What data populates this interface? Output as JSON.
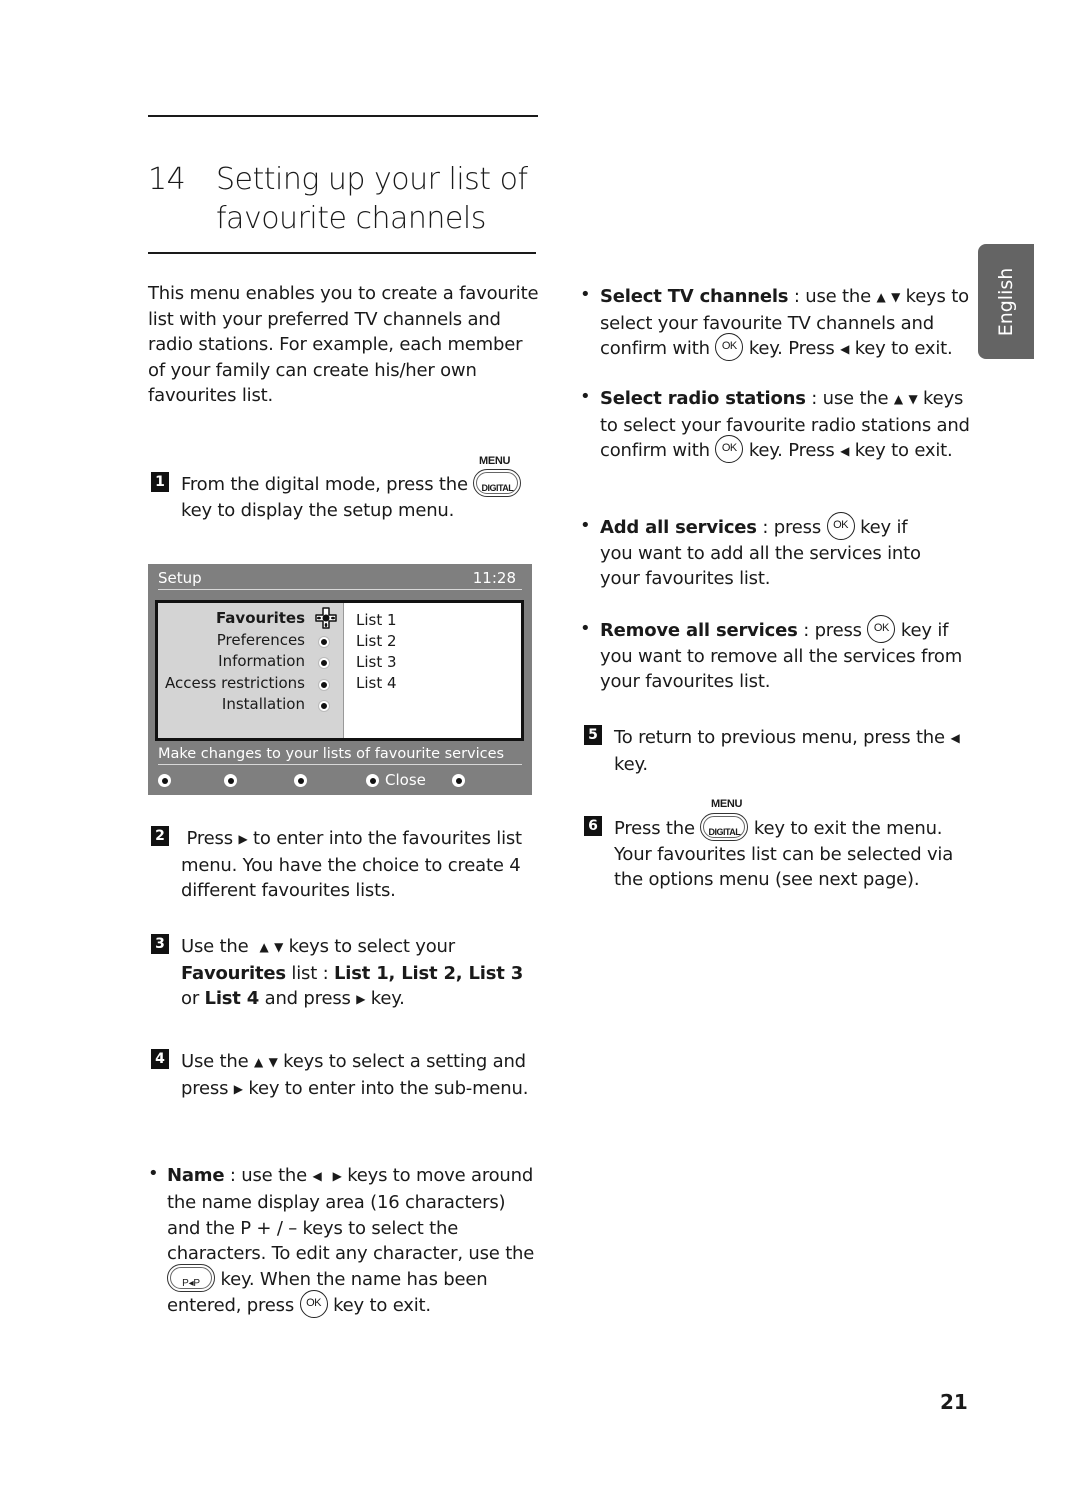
{
  "chapter": {
    "number": "14",
    "title": "Setting up your list of favourite channels"
  },
  "intro": "This menu enables you to create a favourite list with your preferred TV channels and radio stations. For example, each member of your family can create his/her own favourites list.",
  "keys": {
    "menu_label": "MENU",
    "digital_label": "DIGITAL",
    "ok_label": "OK",
    "pp_label": "P◂P"
  },
  "steps": {
    "s1": {
      "num": "1",
      "a": "From the digital mode, press the",
      "b": "key to display the setup menu."
    },
    "s2": {
      "num": "2",
      "a": "Press",
      "b": "to enter into the favourites list menu. You have the choice to create 4 different favourites lists."
    },
    "s3": {
      "num": "3",
      "a": "Use the",
      "b": "keys to select your",
      "fav": "Favourites",
      "c": "list :",
      "lists": "List 1, List 2, List 3",
      "or": "or",
      "list4": "List 4",
      "d": "and press",
      "e": "key."
    },
    "s4": {
      "num": "4",
      "a": "Use the",
      "b": "keys to select a setting and press",
      "c": "key to enter into the sub-menu."
    },
    "s5": {
      "num": "5",
      "a": "To return to previous menu, press the",
      "b": "key."
    },
    "s6": {
      "num": "6",
      "a": "Press the",
      "b": "key to exit the menu. Your favourites list can be selected via the options menu (see next page)."
    }
  },
  "name_bullet": {
    "label": "Name",
    "a": ": use the",
    "b": "keys to move around the name display area (16 characters) and the  P + / – keys to select the characters. To edit any character, use the",
    "c": "key. When the name has been entered, press",
    "d": "key to exit."
  },
  "bullets": [
    {
      "label": "Select TV channels",
      "a": ": use the",
      "b": "keys to select your favourite TV channels and confirm with",
      "c": "key. Press",
      "d": "key to exit."
    },
    {
      "label": "Select radio stations",
      "a": ": use the",
      "b": "keys to select your favourite radio stations and confirm with",
      "c": "key. Press",
      "d": "key to exit."
    },
    {
      "label": "Add all services",
      "a": ": press",
      "b": "key if you want to add all the services into your favourites list."
    },
    {
      "label": "Remove all services",
      "a": ": press",
      "b": "key if you want to remove all the services from your favourites list."
    }
  ],
  "tv_screen": {
    "title": "Setup",
    "clock": "11:28",
    "menu_items": [
      "Favourites",
      "Preferences",
      "Information",
      "Access restrictions",
      "Installation"
    ],
    "selected_item": "Favourites",
    "sub_items": [
      "List 1",
      "List 2",
      "List 3",
      "List 4"
    ],
    "status": "Make changes to your lists of favourite services",
    "footer_close": "Close"
  },
  "language_tab": "English",
  "page_number": "21",
  "colors": {
    "tv_bg": "#7f7f7f",
    "tab_bg": "#646464"
  }
}
